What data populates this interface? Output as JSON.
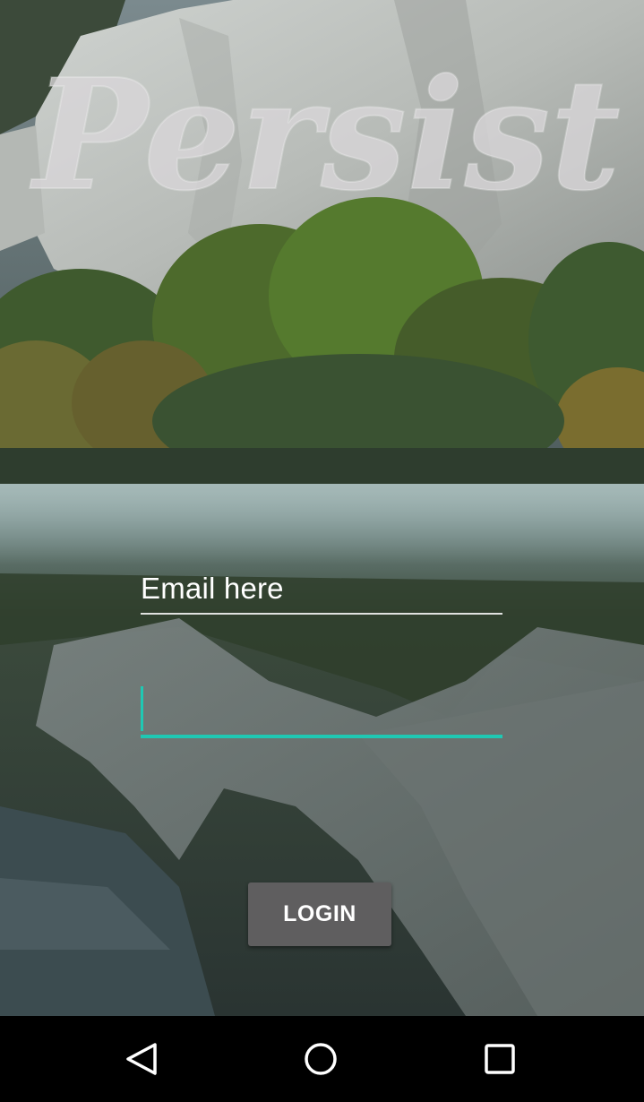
{
  "app": {
    "logo_text": "Persist"
  },
  "login_form": {
    "email_placeholder": "Email here",
    "password_value": "",
    "login_label": "LOGIN"
  },
  "colors": {
    "accent": "#1fc8b3",
    "button_bg": "#5f5e5f",
    "navbar_bg": "#000000"
  },
  "navbar": {
    "back_icon": "back-triangle-icon",
    "home_icon": "home-circle-icon",
    "recent_icon": "recent-apps-square-icon"
  }
}
